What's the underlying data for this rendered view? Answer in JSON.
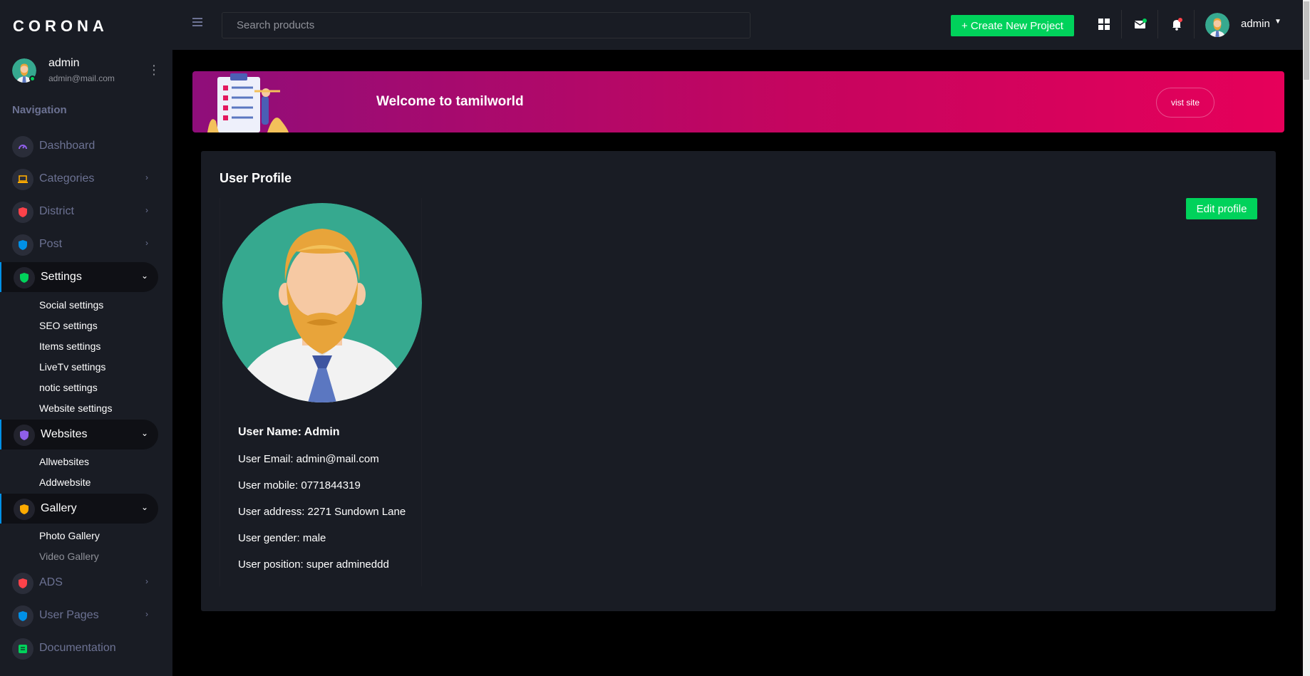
{
  "brand": "CORONA",
  "user": {
    "name": "admin",
    "email": "admin@mail.com"
  },
  "sidebar": {
    "heading": "Navigation",
    "items": [
      {
        "label": "Dashboard",
        "icon": "speedometer-icon",
        "color": "#8f5fe8"
      },
      {
        "label": "Categories",
        "icon": "laptop-icon",
        "color": "#ffab00"
      },
      {
        "label": "District",
        "icon": "security-icon",
        "color": "#fc424a"
      },
      {
        "label": "Post",
        "icon": "shield-icon",
        "color": "#0090e7"
      },
      {
        "label": "Settings",
        "icon": "shield-icon",
        "color": "#00d25b"
      },
      {
        "label": "Websites",
        "icon": "shield-icon",
        "color": "#8f5fe8"
      },
      {
        "label": "Gallery",
        "icon": "shield-icon",
        "color": "#ffab00"
      },
      {
        "label": "ADS",
        "icon": "shield-icon",
        "color": "#fc424a"
      },
      {
        "label": "User Pages",
        "icon": "shield-icon",
        "color": "#0090e7"
      },
      {
        "label": "Documentation",
        "icon": "document-icon",
        "color": "#00d25b"
      }
    ],
    "settings_sub": [
      "Social settings",
      "SEO settings",
      "Items settings",
      "LiveTv settings",
      "notic settings",
      "Website settings"
    ],
    "websites_sub": [
      "Allwebsites",
      "Addwebsite"
    ],
    "gallery_sub": [
      "Photo Gallery",
      "Video Gallery"
    ]
  },
  "navbar": {
    "search_placeholder": "Search products",
    "create_label": "+ Create New Project",
    "user_name": "admin"
  },
  "banner": {
    "title": "Welcome to tamilworld",
    "button": "vist site"
  },
  "profile_card": {
    "title": "User Profile",
    "edit_label": "Edit profile",
    "fields": [
      "User Name: Admin",
      "User Email: admin@mail.com",
      "User mobile: 0771844319",
      "User address: 2271 Sundown Lane",
      "User gender: male",
      "User position: super admineddd"
    ]
  },
  "colors": {
    "accent_green": "#00d25b",
    "sidebar_bg": "#191c24",
    "banner_start": "#8f0e7a",
    "banner_end": "#e6005a"
  }
}
